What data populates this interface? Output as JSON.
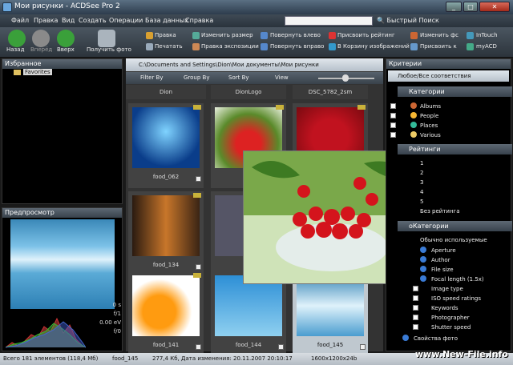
{
  "window": {
    "title": "Мои рисунки - ACDSee Pro 2"
  },
  "menu": [
    "Файл",
    "Правка",
    "Вид",
    "Создать",
    "Операции",
    "База данных",
    "Справка"
  ],
  "quick_search": {
    "label": "Быстрый Поиск",
    "placeholder": ""
  },
  "toolbar": {
    "back": "Назад",
    "forward": "Вперёд",
    "up": "Вверх",
    "get_photos": "Получить фото",
    "edit": "Правка",
    "print": "Печатать",
    "resize": "Изменить размер",
    "exposure": "Правка экспозиции",
    "rotate_left": "Повернуть влево",
    "rotate_right": "Повернуть вправо",
    "rating": "Присвоить рейтинг",
    "basket": "В Корзину изображений",
    "change_fc": "Изменить фс",
    "assign_k": "Присвоить к",
    "intouch": "InTouch",
    "myacd": "myACD"
  },
  "favorites": {
    "title": "Избранное",
    "item": "Favorites"
  },
  "preview": {
    "title": "Предпросмотр",
    "info": [
      "0 s",
      "f/1",
      "0.00 eV",
      "f/0"
    ]
  },
  "browser": {
    "path": "C:\\Documents and Settings\\Dion\\Мои документы\\Мои рисунки",
    "filter": "Filter By",
    "group": "Group By",
    "sort": "Sort By",
    "view": "View",
    "top_labels": [
      "Dion",
      "DionLogo",
      "DSC_5782_2sm"
    ],
    "thumbs": [
      "food_062",
      "",
      "",
      "food_134",
      "",
      "",
      "food_141",
      "food_144",
      "food_145"
    ]
  },
  "criteria": {
    "title": "Критерии",
    "selector": "Любое/Все соответствия",
    "categories_title": "Категории",
    "categories": [
      "Albums",
      "People",
      "Places",
      "Various"
    ],
    "ratings_title": "Рейтинги",
    "ratings": [
      "1",
      "2",
      "3",
      "4",
      "5",
      "Без рейтинга"
    ],
    "auto_title": "оКатегории",
    "auto": [
      "Обычно используемые",
      "Aperture",
      "Author",
      "File size",
      "Focal length (1.5x)",
      "Image type",
      "ISO speed ratings",
      "Keywords",
      "Photographer",
      "Shutter speed"
    ],
    "props": "Свойства фото"
  },
  "status": {
    "total": "Всего 181 элементов  (118,4 Мб)",
    "file": "food_145",
    "info": "277,4 Кб, Дата изменения: 20.11.2007 20:10:17",
    "dims": "1600x1200x24b"
  },
  "watermark": "www.New-File.info"
}
